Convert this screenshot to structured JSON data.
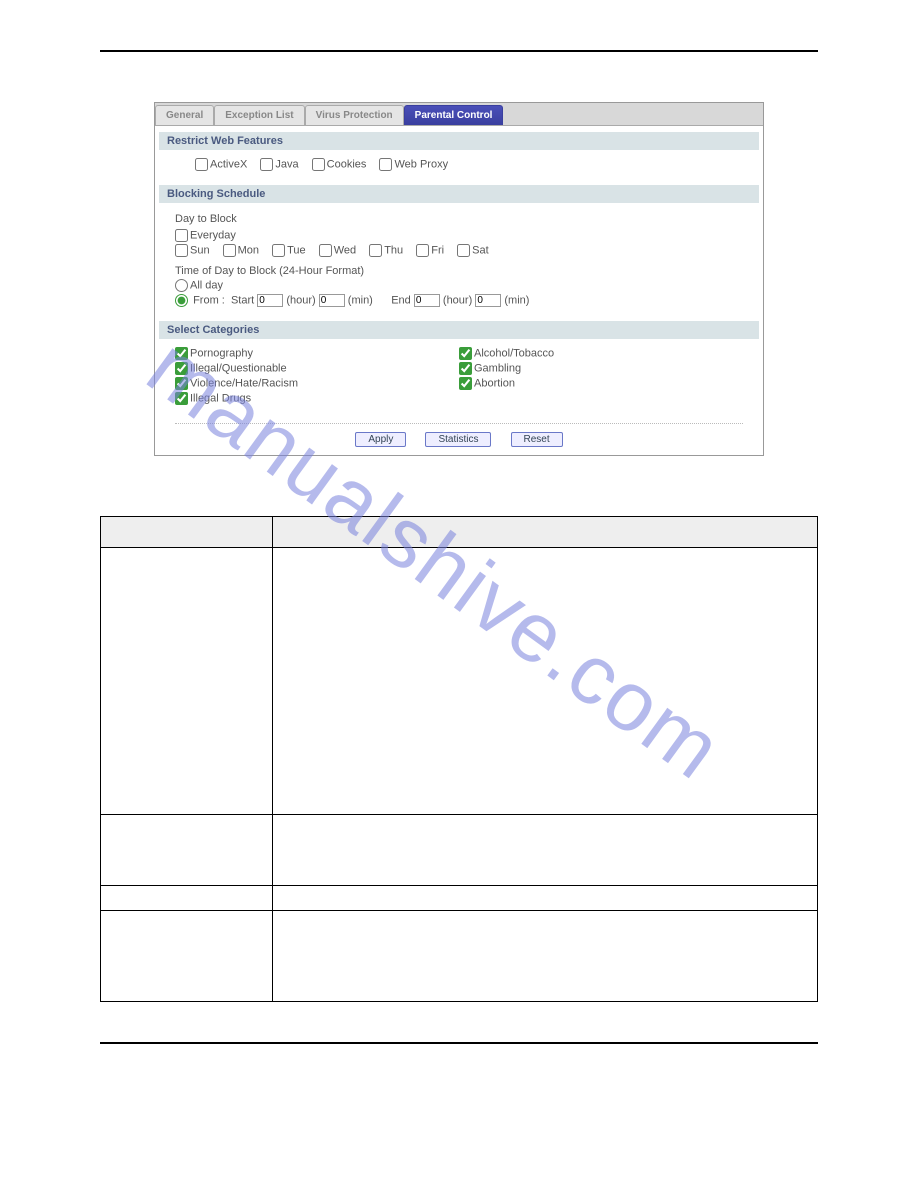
{
  "tabs": {
    "general": "General",
    "exception": "Exception List",
    "virus": "Virus Protection",
    "parental": "Parental Control"
  },
  "sections": {
    "restrict": "Restrict Web Features",
    "blocking": "Blocking Schedule",
    "categories": "Select Categories"
  },
  "restrict": {
    "activex": "ActiveX",
    "java": "Java",
    "cookies": "Cookies",
    "webproxy": "Web Proxy"
  },
  "blocking": {
    "dayToBlock": "Day to Block",
    "everyday": "Everyday",
    "sun": "Sun",
    "mon": "Mon",
    "tue": "Tue",
    "wed": "Wed",
    "thu": "Thu",
    "fri": "Fri",
    "sat": "Sat",
    "timeLabel": "Time of Day to Block  (24-Hour Format)",
    "allDay": "All day",
    "fromLabel": "From :",
    "start": "Start",
    "end": "End",
    "hourUnit": "(hour)",
    "minUnit": "(min)",
    "startHour": "0",
    "startMin": "0",
    "endHour": "0",
    "endMin": "0"
  },
  "categories": {
    "left": [
      "Pornography",
      "Illegal/Questionable",
      "Violence/Hate/Racism",
      "Illegal Drugs"
    ],
    "right": [
      "Alcohol/Tobacco",
      "Gambling",
      "Abortion"
    ]
  },
  "buttons": {
    "apply": "Apply",
    "statistics": "Statistics",
    "reset": "Reset"
  },
  "watermark": "manualshive.com"
}
